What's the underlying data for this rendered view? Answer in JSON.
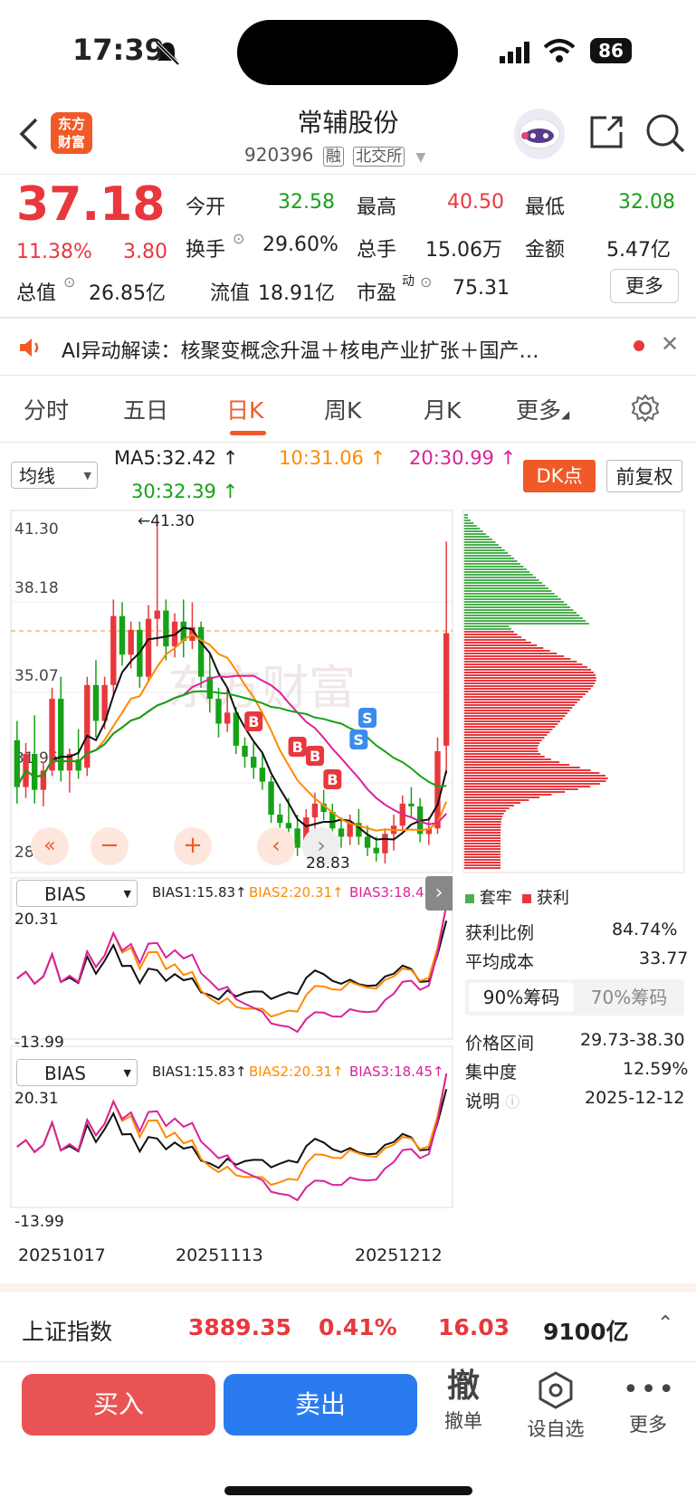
{
  "status": {
    "time": "17:39",
    "battery": "86"
  },
  "header": {
    "title": "常辅股份",
    "code": "920396",
    "tag1": "融",
    "tag2": "北交所",
    "logo_line1": "东方",
    "logo_line2": "财富"
  },
  "quote": {
    "price": "37.18",
    "change_pct": "11.38%",
    "change": "3.80",
    "open_label": "今开",
    "open": "32.58",
    "high_label": "最高",
    "high": "40.50",
    "low_label": "最低",
    "low": "32.08",
    "turnover_label": "换手",
    "turnover": "29.60%",
    "volume_label": "总手",
    "volume": "15.06万",
    "amount_label": "金额",
    "amount": "5.47亿",
    "mcap_label": "总值",
    "mcap": "26.85亿",
    "float_label": "流值",
    "float_val": "18.91亿",
    "pe_label": "市盈",
    "pe_sup": "动",
    "pe": "75.31",
    "more": "更多"
  },
  "news": {
    "text": "AI异动解读：核聚变概念升温＋核电产业扩张＋国产…"
  },
  "tabs": [
    "分时",
    "五日",
    "日K",
    "周K",
    "月K",
    "更多"
  ],
  "indicator": {
    "select": "均线",
    "ma5": "MA5:32.42",
    "ma10": "10:31.06",
    "ma20": "20:30.99",
    "ma30": "30:32.39",
    "dk": "DK点",
    "fq": "前复权",
    "color_up": "#e8383d",
    "color_down": "#16a216"
  },
  "chart_data": {
    "type": "candlestick",
    "price_axis": [
      "41.30",
      "38.18",
      "35.07",
      "31.95",
      "28.83"
    ],
    "ylim": [
      28.83,
      41.3
    ],
    "high_label": "41.30",
    "low_label": "28.83",
    "x_ticks": [
      "20251017",
      "20251113",
      "20251212"
    ],
    "bias_select": "BIAS",
    "bias1": "BIAS1:15.83",
    "bias2": "BIAS2:20.31",
    "bias3": "BIAS3:18.45",
    "bias_top": "20.31",
    "bias_bottom": "-13.99",
    "candles": [
      [
        33.3,
        34.0,
        31.0,
        31.6
      ],
      [
        31.6,
        33.2,
        31.2,
        32.8
      ],
      [
        32.8,
        34.2,
        31.0,
        31.5
      ],
      [
        31.5,
        32.5,
        30.9,
        32.2
      ],
      [
        32.2,
        35.2,
        32.0,
        34.8
      ],
      [
        34.8,
        35.6,
        31.8,
        32.2
      ],
      [
        32.2,
        33.0,
        31.4,
        32.8
      ],
      [
        32.6,
        33.7,
        31.9,
        32.2
      ],
      [
        32.3,
        35.6,
        32.0,
        35.3
      ],
      [
        35.3,
        36.2,
        33.4,
        34.0
      ],
      [
        34.0,
        35.6,
        33.7,
        35.3
      ],
      [
        35.3,
        38.4,
        34.9,
        37.8
      ],
      [
        37.8,
        38.3,
        36.0,
        36.4
      ],
      [
        36.4,
        37.6,
        35.9,
        37.3
      ],
      [
        37.3,
        37.6,
        35.2,
        35.6
      ],
      [
        35.6,
        38.2,
        35.4,
        37.7
      ],
      [
        37.7,
        41.3,
        36.7,
        38.0
      ],
      [
        38.0,
        38.4,
        36.2,
        36.7
      ],
      [
        36.7,
        37.9,
        36.3,
        37.6
      ],
      [
        37.6,
        38.4,
        36.3,
        36.9
      ],
      [
        36.9,
        38.3,
        36.6,
        37.4
      ],
      [
        37.4,
        37.6,
        35.2,
        35.6
      ],
      [
        35.6,
        36.4,
        34.3,
        34.8
      ],
      [
        34.8,
        35.2,
        33.4,
        33.9
      ],
      [
        33.9,
        35.2,
        33.6,
        34.3
      ],
      [
        34.3,
        34.5,
        32.8,
        33.1
      ],
      [
        33.1,
        33.4,
        32.3,
        32.7
      ],
      [
        32.7,
        33.2,
        31.9,
        32.3
      ],
      [
        32.3,
        32.8,
        31.5,
        31.8
      ],
      [
        31.8,
        32.0,
        30.3,
        30.6
      ],
      [
        30.6,
        31.0,
        29.9,
        30.3
      ],
      [
        30.3,
        31.2,
        29.6,
        30.1
      ],
      [
        30.1,
        30.6,
        29.1,
        29.4
      ],
      [
        29.4,
        30.8,
        29.2,
        30.5
      ],
      [
        30.5,
        31.4,
        29.9,
        31.0
      ],
      [
        31.0,
        31.5,
        30.4,
        30.7
      ],
      [
        30.7,
        31.0,
        29.9,
        30.1
      ],
      [
        30.1,
        30.5,
        29.4,
        29.8
      ],
      [
        29.8,
        30.6,
        29.5,
        30.3
      ],
      [
        30.3,
        30.8,
        29.5,
        29.8
      ],
      [
        29.8,
        30.2,
        29.1,
        29.4
      ],
      [
        29.4,
        29.8,
        28.9,
        29.2
      ],
      [
        29.2,
        30.1,
        28.83,
        29.9
      ],
      [
        29.9,
        30.6,
        29.3,
        30.2
      ],
      [
        30.2,
        31.3,
        30.0,
        31.0
      ],
      [
        31.0,
        31.6,
        30.5,
        30.9
      ],
      [
        30.9,
        31.2,
        29.6,
        29.9
      ],
      [
        29.9,
        30.5,
        29.5,
        30.1
      ],
      [
        30.1,
        33.4,
        29.9,
        32.9
      ],
      [
        33.1,
        40.5,
        32.08,
        37.18
      ]
    ],
    "legend": {
      "trapped": "套牢",
      "profit": "获利"
    }
  },
  "chips": {
    "profit_label": "获利比例",
    "profit": "84.74%",
    "avg_label": "平均成本",
    "avg": "33.77",
    "tab90": "90%筹码",
    "tab70": "70%筹码",
    "range_label": "价格区间",
    "range": "29.73-38.30",
    "conc_label": "集中度",
    "conc": "12.59%",
    "note_label": "说明",
    "date": "2025-12-12"
  },
  "index_bar": {
    "name": "上证指数",
    "value": "3889.35",
    "pct": "0.41%",
    "change": "16.03",
    "amount": "9100亿"
  },
  "bottom": {
    "buy": "买入",
    "sell": "卖出",
    "cancel_icon": "撤",
    "cancel": "撤单",
    "watch": "设自选",
    "more": "更多"
  }
}
